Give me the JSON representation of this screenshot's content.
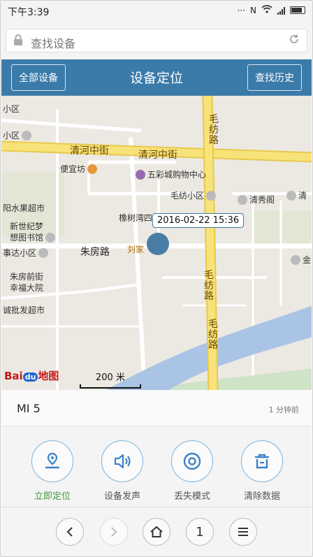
{
  "status_bar": {
    "time": "下午3:39"
  },
  "address_bar": {
    "placeholder": "查找设备"
  },
  "header": {
    "left_button": "全部设备",
    "title": "设备定位",
    "right_button": "查找历史"
  },
  "map": {
    "road_labels": {
      "qinghe_1": "清河中街",
      "qinghe_2": "清河中街",
      "zhufang": "朱房路",
      "maofang_top": "毛纺路",
      "maofang_mid": "毛纺路",
      "maofang_low": "毛纺路"
    },
    "pois": {
      "xiaoqu_top": "小区",
      "xiaoqu_mid": "小区",
      "bianyifang": "便宜坊",
      "wucaicheng": "五彩城购物中心",
      "maofang_xiaoqu": "毛纺小区",
      "qingxiuge": "清秀阁",
      "qing_right": "清",
      "shuiguo": "阳水果超市",
      "xiangshu": "橡树湾四",
      "xinshiji": "新世纪梦",
      "xiangtu": "想图书馆",
      "shida": "事达小区",
      "liujia": "刘家",
      "jin": "金",
      "zhufang_qianjie": "朱房前街",
      "xingfu": "幸福大院",
      "chengpifa": "诚批发超市"
    },
    "location_time": "2016-02-22 15:36",
    "baidu_logo": "Baidu地图",
    "scale_label": "200 米"
  },
  "device": {
    "name": "MI 5",
    "updated": "1 分钟前"
  },
  "actions": [
    {
      "label": "立即定位",
      "icon": "location-icon"
    },
    {
      "label": "设备发声",
      "icon": "speaker-icon"
    },
    {
      "label": "丢失模式",
      "icon": "lost-mode-icon"
    },
    {
      "label": "清除数据",
      "icon": "trash-icon"
    }
  ],
  "nav_bar": {
    "tab_count": "1"
  },
  "colors": {
    "header": "#3b7ba9",
    "marker": "#4a7da6",
    "accent_green": "#3a9a3a",
    "road_yellow": "#f3dc6b"
  }
}
